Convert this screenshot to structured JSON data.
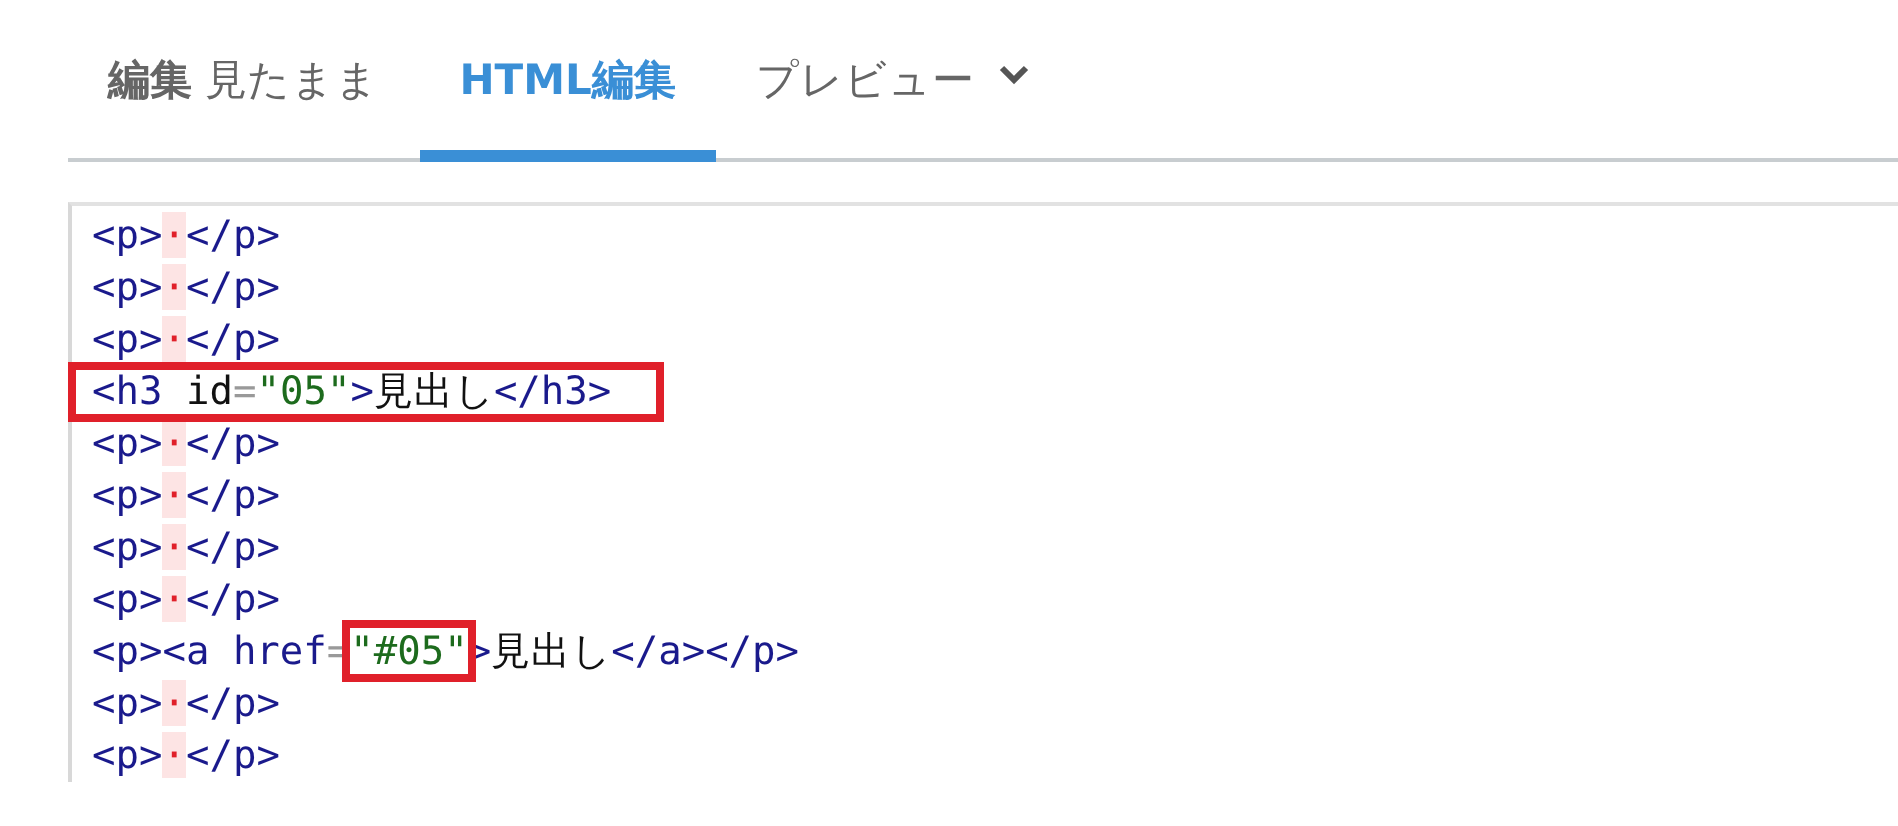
{
  "tabs": [
    {
      "label": "**編集** 見たまま",
      "selected": false,
      "dropdown": false
    },
    {
      "label": "HTML編集",
      "selected": true,
      "dropdown": false
    },
    {
      "label": "プレビュー",
      "selected": false,
      "dropdown": true
    }
  ],
  "code_lines": [
    {
      "highlighted": false,
      "tokens": [
        {
          "kind": "tag",
          "text": "<p>"
        },
        {
          "kind": "nbsp",
          "text": "·"
        },
        {
          "kind": "tag",
          "text": "</p>"
        }
      ]
    },
    {
      "highlighted": false,
      "tokens": [
        {
          "kind": "tag",
          "text": "<p>"
        },
        {
          "kind": "nbsp",
          "text": "·"
        },
        {
          "kind": "tag",
          "text": "</p>"
        }
      ]
    },
    {
      "highlighted": false,
      "tokens": [
        {
          "kind": "tag",
          "text": "<p>"
        },
        {
          "kind": "nbsp",
          "text": "·"
        },
        {
          "kind": "tag",
          "text": "</p>"
        }
      ]
    },
    {
      "highlighted": true,
      "tokens": [
        {
          "kind": "tag",
          "text": "<h3"
        },
        {
          "kind": "attr",
          "text": " id"
        },
        {
          "kind": "eq",
          "text": "="
        },
        {
          "kind": "string",
          "text": "\"05\""
        },
        {
          "kind": "tag",
          "text": ">"
        },
        {
          "kind": "text",
          "text": "見出し"
        },
        {
          "kind": "tag",
          "text": "</h3>"
        }
      ]
    },
    {
      "highlighted": false,
      "tokens": [
        {
          "kind": "tag",
          "text": "<p>"
        },
        {
          "kind": "nbsp",
          "text": "·"
        },
        {
          "kind": "tag",
          "text": "</p>"
        }
      ]
    },
    {
      "highlighted": false,
      "tokens": [
        {
          "kind": "tag",
          "text": "<p>"
        },
        {
          "kind": "nbsp",
          "text": "·"
        },
        {
          "kind": "tag",
          "text": "</p>"
        }
      ]
    },
    {
      "highlighted": false,
      "tokens": [
        {
          "kind": "tag",
          "text": "<p>"
        },
        {
          "kind": "nbsp",
          "text": "·"
        },
        {
          "kind": "tag",
          "text": "</p>"
        }
      ]
    },
    {
      "highlighted": false,
      "tokens": [
        {
          "kind": "tag",
          "text": "<p>"
        },
        {
          "kind": "nbsp",
          "text": "·"
        },
        {
          "kind": "tag",
          "text": "</p>"
        }
      ]
    },
    {
      "highlighted": false,
      "tokens": [
        {
          "kind": "tag",
          "text": "<p><a"
        },
        {
          "kind": "tag",
          "text": " href"
        },
        {
          "kind": "eq",
          "text": "="
        },
        {
          "kind": "string",
          "text": "\"#05\"",
          "highlighted": true
        },
        {
          "kind": "tag",
          "text": ">"
        },
        {
          "kind": "text",
          "text": "見出し"
        },
        {
          "kind": "tag",
          "text": "</a></p>"
        }
      ]
    },
    {
      "highlighted": false,
      "tokens": [
        {
          "kind": "tag",
          "text": "<p>"
        },
        {
          "kind": "nbsp",
          "text": "·"
        },
        {
          "kind": "tag",
          "text": "</p>"
        }
      ]
    },
    {
      "highlighted": false,
      "tokens": [
        {
          "kind": "tag",
          "text": "<p>"
        },
        {
          "kind": "nbsp",
          "text": "·"
        },
        {
          "kind": "tag",
          "text": "</p>"
        }
      ]
    }
  ]
}
